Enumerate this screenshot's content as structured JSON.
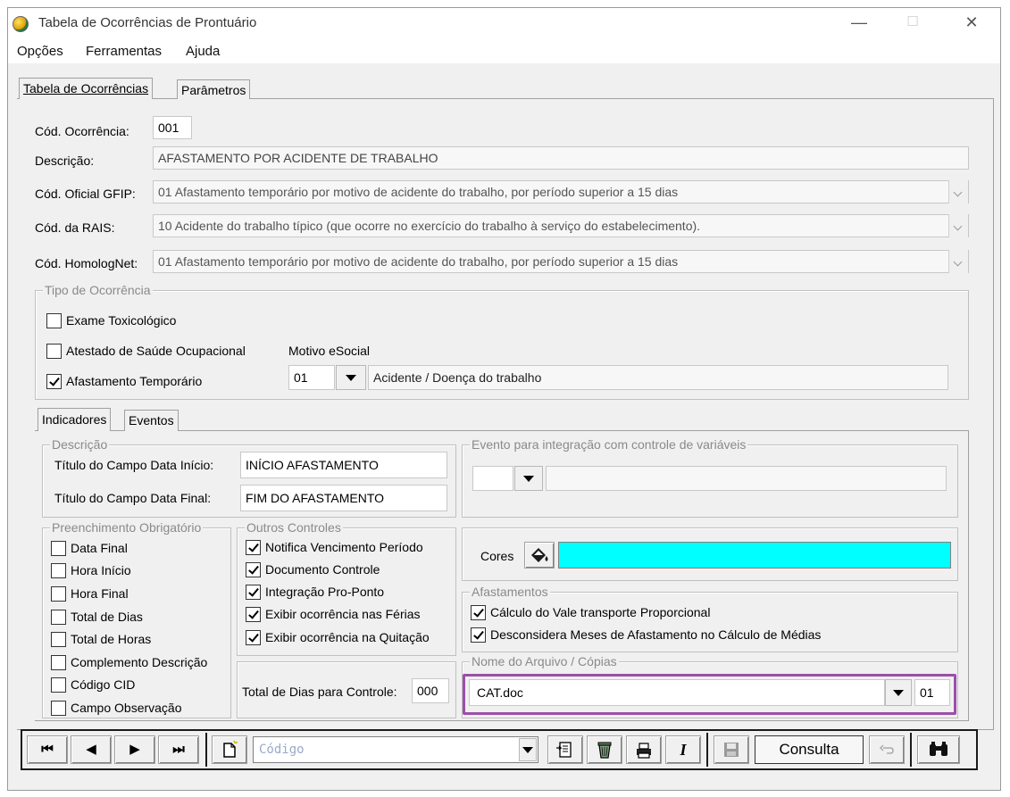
{
  "window": {
    "title": "Tabela de Ocorrências de Prontuário",
    "minimize": "—",
    "maximize": "☐",
    "close": "✕"
  },
  "menu": {
    "items": [
      "Opções",
      "Ferramentas",
      "Ajuda"
    ]
  },
  "tabs": [
    "Tabela de Ocorrências",
    "Parâmetros"
  ],
  "form": {
    "cod_ocorrencia_label": "Cód. Ocorrência:",
    "cod_ocorrencia_value": "001",
    "descricao_label": "Descrição:",
    "descricao_value": "AFASTAMENTO POR ACIDENTE DE TRABALHO",
    "gfip_label": "Cód. Oficial GFIP:",
    "gfip_value": "01 Afastamento temporário por motivo de acidente do trabalho, por período superior a 15 dias",
    "rais_label": "Cód. da RAIS:",
    "rais_value": "10 Acidente do trabalho típico (que ocorre no exercício do trabalho à serviço do estabelecimento).",
    "homolognet_label": "Cód. HomologNet:",
    "homolognet_value": "01  Afastamento temporário por motivo de acidente do trabalho, por período superior a 15 dias"
  },
  "tipo_ocorrencia": {
    "title": "Tipo de Ocorrência",
    "exame": "Exame Toxicológico",
    "atestado": "Atestado de Saúde Ocupacional",
    "afastamento": "Afastamento Temporário",
    "motivo_label": "Motivo eSocial",
    "motivo_code": "01",
    "motivo_desc": "Acidente / Doença do trabalho"
  },
  "subtabs": [
    "Indicadores",
    "Eventos"
  ],
  "descricao_group": {
    "title": "Descrição",
    "inicio_label": "Título do Campo Data Início:",
    "inicio_value": "INÍCIO AFASTAMENTO",
    "final_label": "Título do Campo Data Final:",
    "final_value": "FIM DO AFASTAMENTO"
  },
  "evento_group": {
    "title": "Evento para integração com controle de variáveis"
  },
  "preenchimento": {
    "title": "Preenchimento Obrigatório",
    "items": [
      "Data Final",
      "Hora Início",
      "Hora Final",
      "Total de Dias",
      "Total de Horas",
      "Complemento Descrição",
      "Código CID",
      "Campo Observação"
    ]
  },
  "outros": {
    "title": "Outros Controles",
    "items": [
      "Notifica Vencimento Período",
      "Documento Controle",
      "Integração Pro-Ponto",
      "Exibir ocorrência nas Férias",
      "Exibir ocorrência na Quitação"
    ]
  },
  "cores": {
    "label": "Cores",
    "color": "#00ffff"
  },
  "afastamentos": {
    "title": "Afastamentos",
    "vale": "Cálculo do Vale transporte Proporcional",
    "desconsidera": "Desconsidera Meses de Afastamento no Cálculo de Médias"
  },
  "total_dias": {
    "label": "Total de Dias para Controle:",
    "value": "000"
  },
  "arquivo": {
    "title": "Nome do Arquivo / Cópias",
    "file": "CAT.doc",
    "copies": "01",
    "highlight_color": "#9b4fa8"
  },
  "toolbar": {
    "search_placeholder": "Código",
    "consulta": "Consulta",
    "first": "⏮",
    "prev": "◀",
    "next": "▶",
    "last": "⏭",
    "italic": "I"
  }
}
